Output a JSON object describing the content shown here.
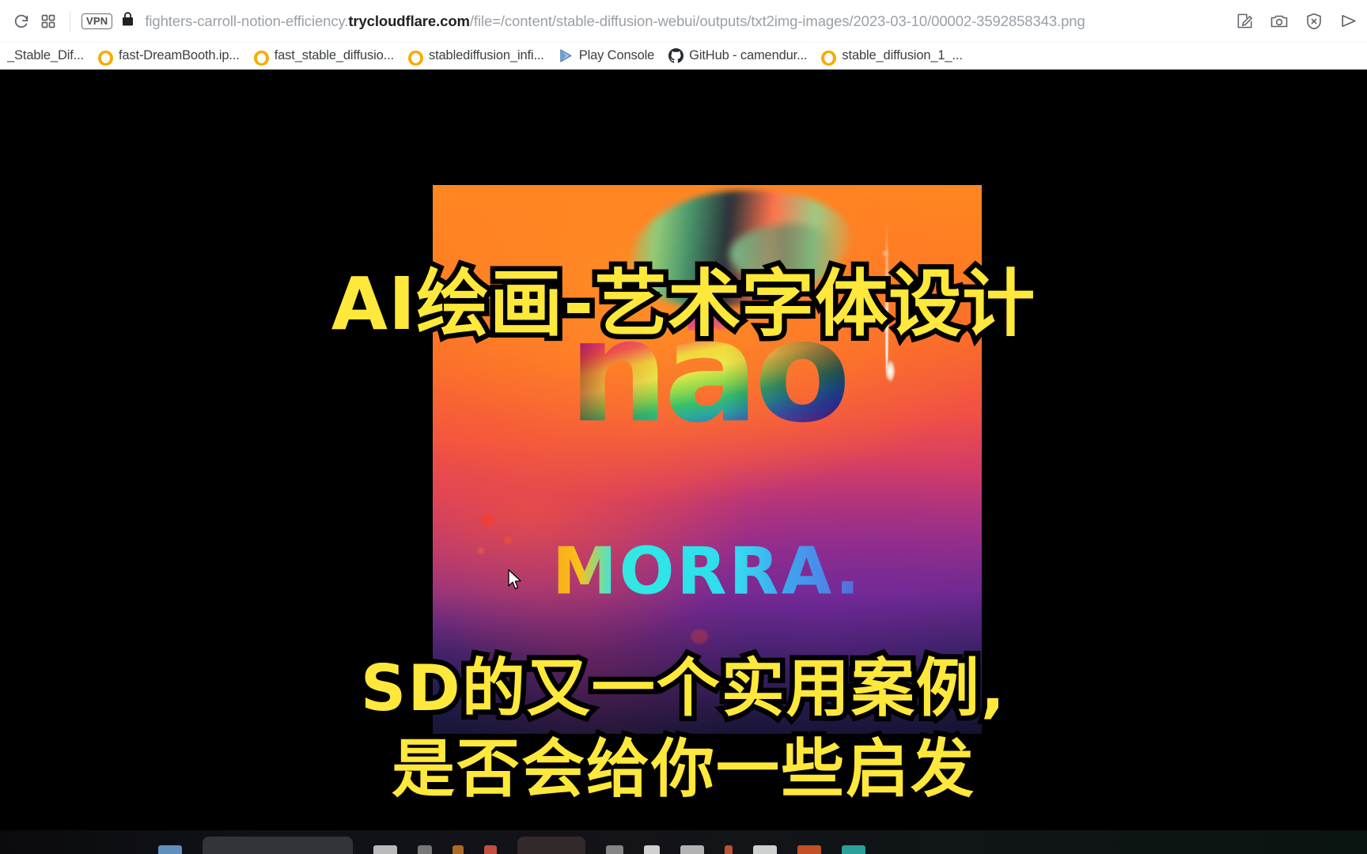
{
  "browser": {
    "toolbar": {
      "reload_icon": "reload-icon",
      "apps_grid_icon": "apps-grid-icon",
      "vpn_badge": "VPN",
      "lock_icon": "lock-icon",
      "url_prefix": "fighters-carroll-notion-efficiency.",
      "url_host": "trycloudflare.com",
      "url_path": "/file=/content/stable-diffusion-webui/outputs/txt2img-images/2023-03-10/00002-3592858343.png",
      "url_full": "fighters-carroll-notion-efficiency.trycloudflare.com/file=/content/stable-diffusion-webui/outputs/txt2img-images/2023-03-10/00002-3592858343.png",
      "right_icons": [
        {
          "name": "annotate-icon",
          "glyph": "annotate"
        },
        {
          "name": "camera-icon",
          "glyph": "camera"
        },
        {
          "name": "shield-block-icon",
          "glyph": "shield"
        },
        {
          "name": "send-icon",
          "glyph": "send"
        }
      ]
    },
    "bookmarks": [
      {
        "label": "_Stable_Dif...",
        "favicon": "none"
      },
      {
        "label": "fast-DreamBooth.ip...",
        "favicon": "colab"
      },
      {
        "label": "fast_stable_diffusio...",
        "favicon": "colab"
      },
      {
        "label": "stablediffusion_infi...",
        "favicon": "colab"
      },
      {
        "label": "Play Console",
        "favicon": "play-console"
      },
      {
        "label": "GitHub - camendur...",
        "favicon": "github"
      },
      {
        "label": "stable_diffusion_1_...",
        "favicon": "colab"
      }
    ]
  },
  "page": {
    "background_color": "#000000",
    "image": {
      "alt": "AI generated typography artwork",
      "headline_word": "não",
      "sub_word": "MORRA.",
      "palette": {
        "top": "#ff8a20",
        "mid": "#cf3a6a",
        "bottom": "#20204c",
        "accent_cyan": "#2ee6e8",
        "accent_yellow": "#f7a81b"
      }
    }
  },
  "overlay": {
    "title": "AI绘画-艺术字体设计",
    "caption_line_1": "SD的又一个实用案例,",
    "caption_line_2": "是否会给你一些启发",
    "text_color": "#ffe83c",
    "outline_color": "#000000"
  },
  "taskbar": {
    "visible": true,
    "background_color": "#101218"
  }
}
